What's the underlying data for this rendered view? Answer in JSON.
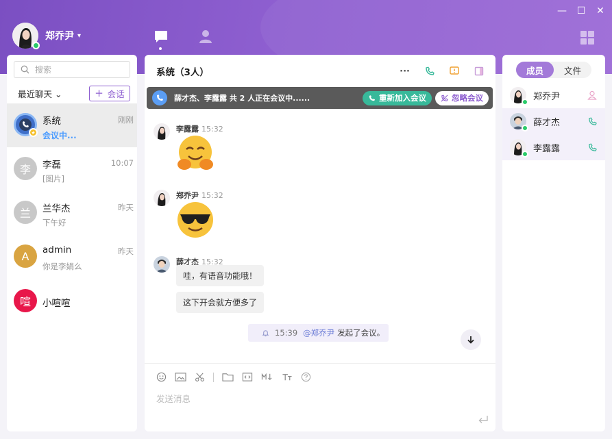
{
  "user": {
    "name": "郑乔尹",
    "caret": "▾"
  },
  "window": {
    "minimize": "—",
    "maximize": "☐",
    "close": "✕"
  },
  "sidebar": {
    "search_placeholder": "搜索",
    "recent_label": "最近聊天",
    "recent_caret": "⌄",
    "new_chat_label": "会话",
    "conversations": [
      {
        "name": "系统",
        "time": "刚刚",
        "message": "会议中...",
        "avatar_text": "",
        "avatar_color": "#3f6fc9"
      },
      {
        "name": "李磊",
        "time": "10:07",
        "message": "[图片]",
        "avatar_text": "李",
        "avatar_color": "#c8c8c8"
      },
      {
        "name": "兰华杰",
        "time": "昨天",
        "message": "下午好",
        "avatar_text": "兰",
        "avatar_color": "#c8c8c8"
      },
      {
        "name": "admin",
        "time": "昨天",
        "message": "你是李娟么",
        "avatar_text": "A",
        "avatar_color": "#d9a441"
      },
      {
        "name": "小喧喧",
        "time": "",
        "message": "",
        "avatar_text": "喧",
        "avatar_color": "#e8174a"
      }
    ]
  },
  "chat": {
    "title": "系统（3人）",
    "more_label": "···",
    "meeting": {
      "text": "薛才杰、李露露 共 2 人正在会议中......",
      "rejoin_label": "重新加入会议",
      "ignore_label": "忽略会议"
    },
    "messages": [
      {
        "sender": "李露露",
        "time": "15:32",
        "emoji": "hug"
      },
      {
        "sender": "郑乔尹",
        "time": "15:32",
        "emoji": "sunglasses"
      },
      {
        "sender": "薛才杰",
        "time": "15:32",
        "texts": [
          "哇，有语音功能哦！",
          "这下开会就方便多了"
        ]
      }
    ],
    "notice": {
      "time": "15:39",
      "mention": "@郑乔尹",
      "action": "发起了会议。"
    },
    "compose_placeholder": "发送消息"
  },
  "members_panel": {
    "tabs": [
      "成员",
      "文件"
    ],
    "members": [
      {
        "name": "郑乔尹",
        "icon": "user-icon"
      },
      {
        "name": "薛才杰",
        "icon": "phone-icon"
      },
      {
        "name": "李露露",
        "icon": "phone-icon"
      }
    ]
  },
  "colors": {
    "brand": "#8e5fd0",
    "meeting_green": "#38b99a",
    "online_green": "#2bcb6b",
    "link_blue": "#4c9cff"
  }
}
